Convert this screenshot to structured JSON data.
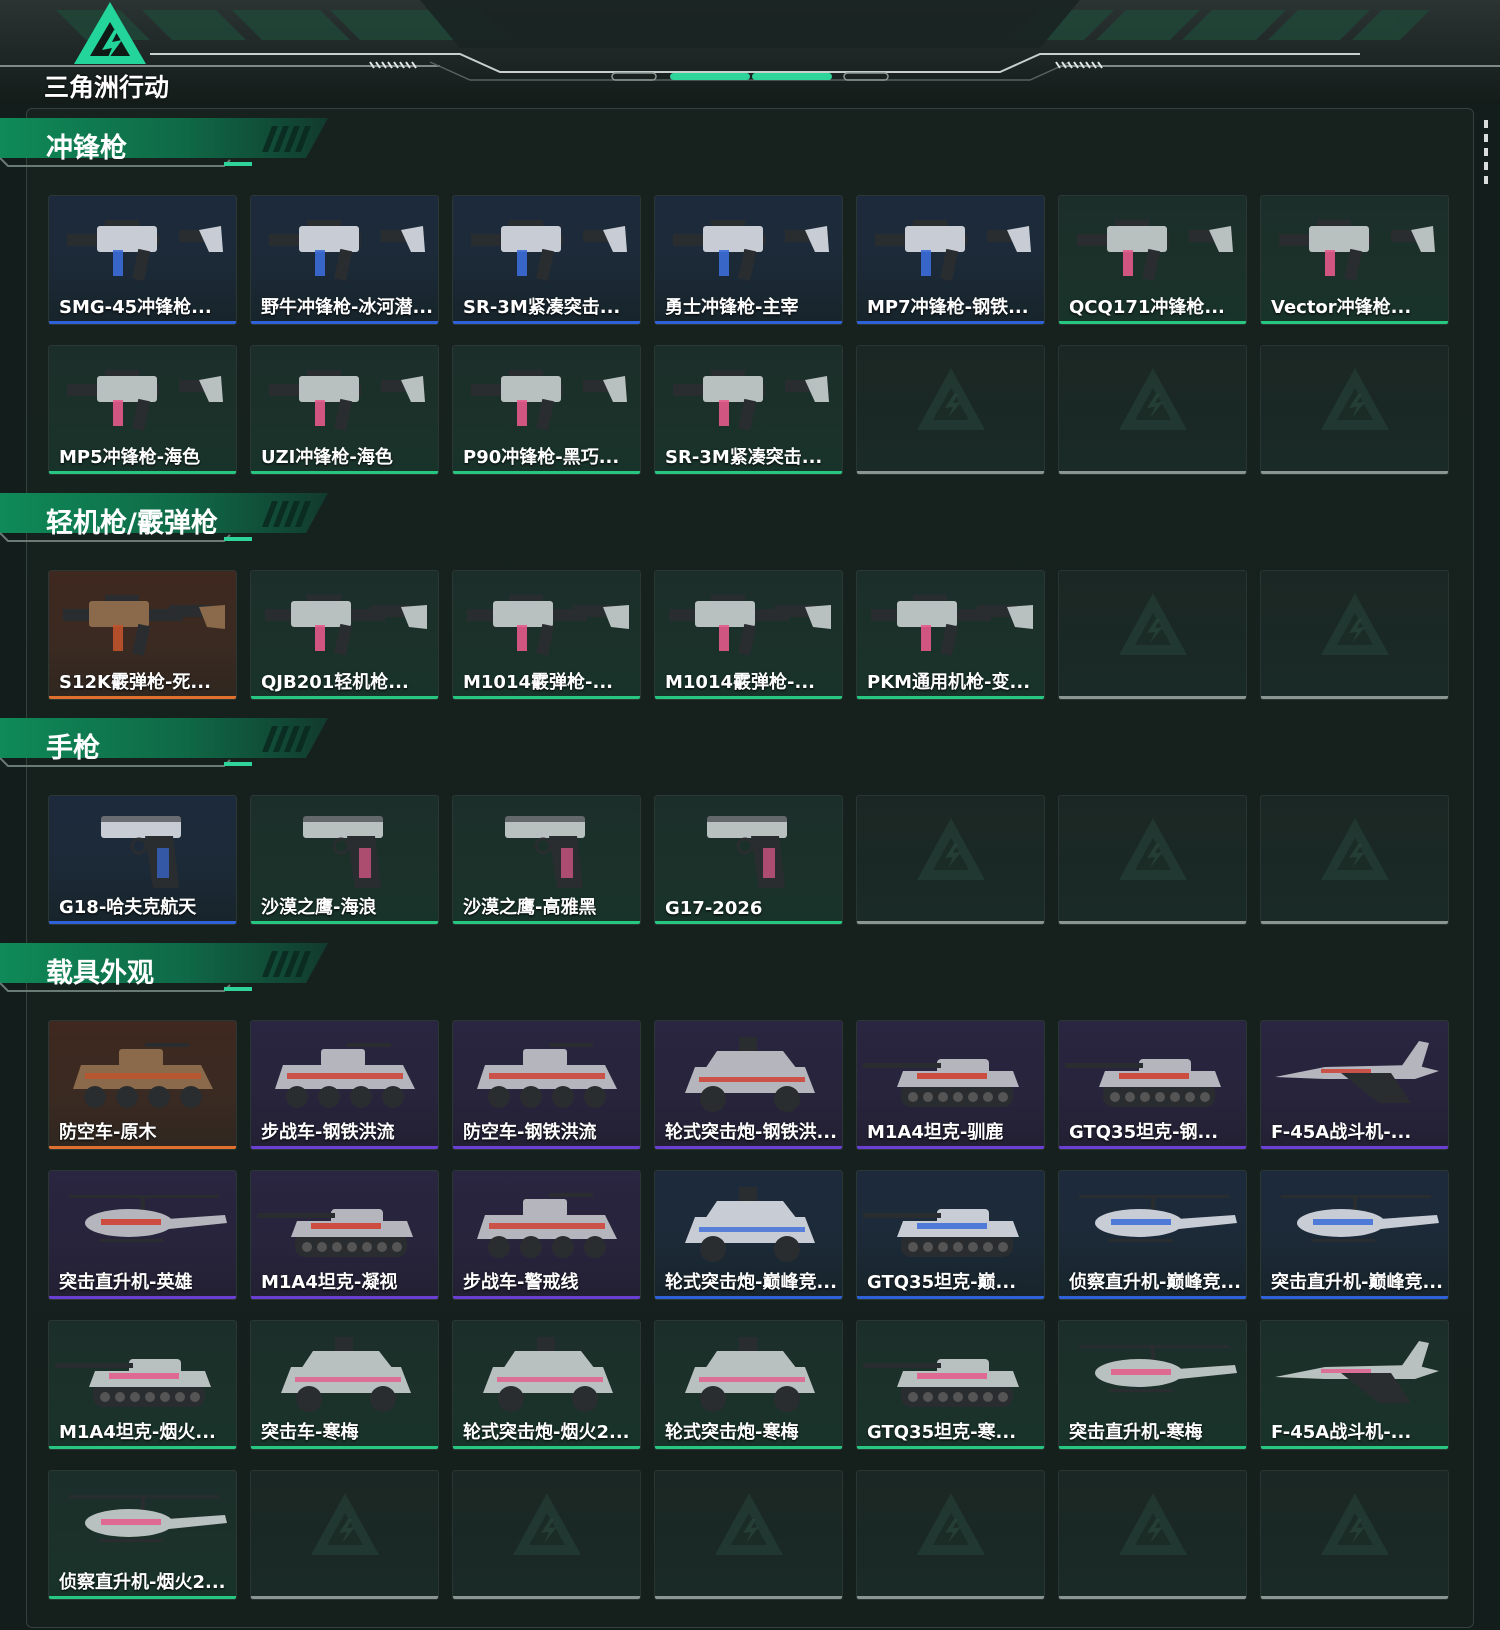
{
  "app": {
    "logo_text": "三角洲行动",
    "colors": {
      "accent": "#27c782",
      "rarity_blue": "#2f62d8",
      "rarity_green": "#27c782",
      "rarity_orange": "#e0702d",
      "rarity_purple": "#6b3fd1",
      "empty_slot": "#8b9692"
    }
  },
  "sections": [
    {
      "title": "冲锋枪",
      "items": [
        {
          "name": "SMG-45冲锋枪...",
          "rarity": "blue",
          "icon": "smg-icon"
        },
        {
          "name": "野牛冲锋枪-冰河潜...",
          "rarity": "blue",
          "icon": "smg-icon"
        },
        {
          "name": "SR-3M紧凑突击...",
          "rarity": "blue",
          "icon": "smg-icon"
        },
        {
          "name": "勇士冲锋枪-主宰",
          "rarity": "blue",
          "icon": "smg-icon"
        },
        {
          "name": "MP7冲锋枪-钢铁...",
          "rarity": "blue",
          "icon": "smg-icon"
        },
        {
          "name": "QCQ171冲锋枪...",
          "rarity": "green",
          "icon": "smg-icon"
        },
        {
          "name": "Vector冲锋枪...",
          "rarity": "green",
          "icon": "smg-icon"
        },
        {
          "name": "MP5冲锋枪-海色",
          "rarity": "green",
          "icon": "smg-icon"
        },
        {
          "name": "UZI冲锋枪-海色",
          "rarity": "green",
          "icon": "smg-icon"
        },
        {
          "name": "P90冲锋枪-黑巧...",
          "rarity": "green",
          "icon": "smg-icon"
        },
        {
          "name": "SR-3M紧凑突击...",
          "rarity": "green",
          "icon": "smg-icon"
        },
        {
          "name": "",
          "rarity": "empty",
          "icon": "empty-slot-icon"
        },
        {
          "name": "",
          "rarity": "empty",
          "icon": "empty-slot-icon"
        },
        {
          "name": "",
          "rarity": "empty",
          "icon": "empty-slot-icon"
        }
      ]
    },
    {
      "title": "轻机枪/霰弹枪",
      "items": [
        {
          "name": "S12K霰弹枪-死...",
          "rarity": "orange",
          "icon": "shotgun-icon"
        },
        {
          "name": "QJB201轻机枪...",
          "rarity": "green",
          "icon": "lmg-icon"
        },
        {
          "name": "M1014霰弹枪-...",
          "rarity": "green",
          "icon": "shotgun-icon"
        },
        {
          "name": "M1014霰弹枪-...",
          "rarity": "green",
          "icon": "shotgun-icon"
        },
        {
          "name": "PKM通用机枪-变...",
          "rarity": "green",
          "icon": "lmg-icon"
        },
        {
          "name": "",
          "rarity": "empty",
          "icon": "empty-slot-icon"
        },
        {
          "name": "",
          "rarity": "empty",
          "icon": "empty-slot-icon"
        }
      ]
    },
    {
      "title": "手枪",
      "items": [
        {
          "name": "G18-哈夫克航天",
          "rarity": "blue",
          "icon": "pistol-icon"
        },
        {
          "name": "沙漠之鹰-海浪",
          "rarity": "green",
          "icon": "pistol-icon"
        },
        {
          "name": "沙漠之鹰-高雅黑",
          "rarity": "green",
          "icon": "pistol-icon"
        },
        {
          "name": "G17-2026",
          "rarity": "green",
          "icon": "pistol-icon"
        },
        {
          "name": "",
          "rarity": "empty",
          "icon": "empty-slot-icon"
        },
        {
          "name": "",
          "rarity": "empty",
          "icon": "empty-slot-icon"
        },
        {
          "name": "",
          "rarity": "empty",
          "icon": "empty-slot-icon"
        }
      ]
    },
    {
      "title": "载具外观",
      "items": [
        {
          "name": "防空车-原木",
          "rarity": "orange",
          "icon": "apc-icon"
        },
        {
          "name": "步战车-钢铁洪流",
          "rarity": "purple",
          "icon": "apc-icon"
        },
        {
          "name": "防空车-钢铁洪流",
          "rarity": "purple",
          "icon": "apc-icon"
        },
        {
          "name": "轮式突击炮-钢铁洪...",
          "rarity": "purple",
          "icon": "armored-car-icon"
        },
        {
          "name": "M1A4坦克-驯鹿",
          "rarity": "purple",
          "icon": "tank-icon"
        },
        {
          "name": "GTQ35坦克-钢...",
          "rarity": "purple",
          "icon": "tank-icon"
        },
        {
          "name": "F-45A战斗机-...",
          "rarity": "purple",
          "icon": "jet-icon"
        },
        {
          "name": "突击直升机-英雄",
          "rarity": "purple",
          "icon": "helicopter-icon"
        },
        {
          "name": "M1A4坦克-凝视",
          "rarity": "purple",
          "icon": "tank-icon"
        },
        {
          "name": "步战车-警戒线",
          "rarity": "purple",
          "icon": "apc-icon"
        },
        {
          "name": "轮式突击炮-巅峰竞...",
          "rarity": "blue",
          "icon": "armored-car-icon"
        },
        {
          "name": "GTQ35坦克-巅...",
          "rarity": "blue",
          "icon": "tank-icon"
        },
        {
          "name": "侦察直升机-巅峰竞...",
          "rarity": "blue",
          "icon": "helicopter-icon"
        },
        {
          "name": "突击直升机-巅峰竞...",
          "rarity": "blue",
          "icon": "helicopter-icon"
        },
        {
          "name": "M1A4坦克-烟火...",
          "rarity": "green",
          "icon": "tank-icon"
        },
        {
          "name": "突击车-寒梅",
          "rarity": "green",
          "icon": "armored-car-icon"
        },
        {
          "name": "轮式突击炮-烟火2...",
          "rarity": "green",
          "icon": "armored-car-icon"
        },
        {
          "name": "轮式突击炮-寒梅",
          "rarity": "green",
          "icon": "armored-car-icon"
        },
        {
          "name": "GTQ35坦克-寒...",
          "rarity": "green",
          "icon": "tank-icon"
        },
        {
          "name": "突击直升机-寒梅",
          "rarity": "green",
          "icon": "helicopter-icon"
        },
        {
          "name": "F-45A战斗机-...",
          "rarity": "green",
          "icon": "jet-icon"
        },
        {
          "name": "侦察直升机-烟火2...",
          "rarity": "green",
          "icon": "helicopter-icon"
        },
        {
          "name": "",
          "rarity": "empty",
          "icon": "empty-slot-icon"
        },
        {
          "name": "",
          "rarity": "empty",
          "icon": "empty-slot-icon"
        },
        {
          "name": "",
          "rarity": "empty",
          "icon": "empty-slot-icon"
        },
        {
          "name": "",
          "rarity": "empty",
          "icon": "empty-slot-icon"
        },
        {
          "name": "",
          "rarity": "empty",
          "icon": "empty-slot-icon"
        },
        {
          "name": "",
          "rarity": "empty",
          "icon": "empty-slot-icon"
        }
      ]
    }
  ]
}
